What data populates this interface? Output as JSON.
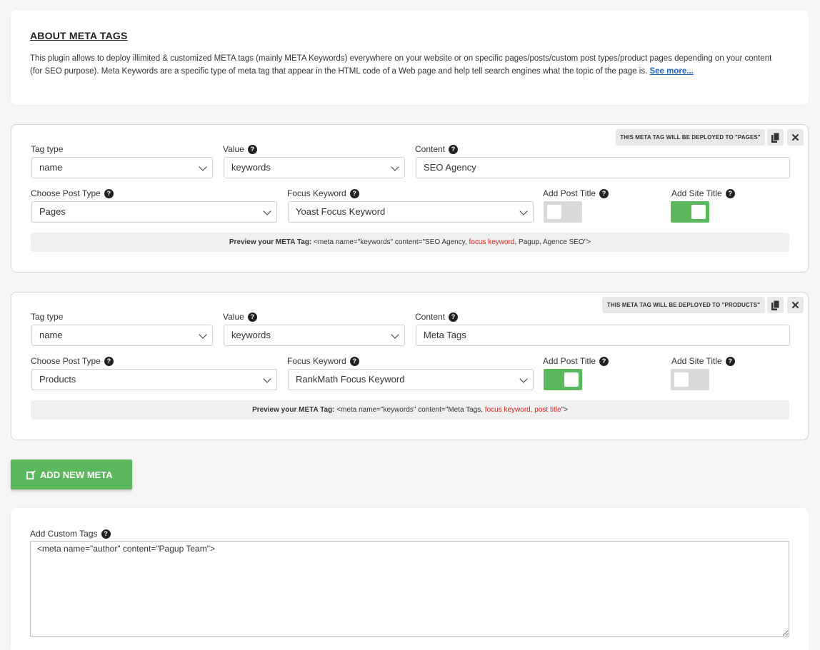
{
  "about": {
    "title": "ABOUT META TAGS",
    "description": "This plugin allows to deploy illimited & customized META tags (mainly META Keywords) everywhere on your website or on specific pages/posts/custom post types/product pages depending on your content (for SEO purpose). Meta Keywords are a specific type of meta tag that appear in the HTML code of a Web page and help tell search engines what the topic of the page is.",
    "see_more": "See more..."
  },
  "labels": {
    "tag_type": "Tag type",
    "value": "Value",
    "content": "Content",
    "choose_post_type": "Choose Post Type",
    "focus_keyword": "Focus Keyword",
    "add_post_title": "Add Post Title",
    "add_site_title": "Add Site Title",
    "preview": "Preview your META Tag:"
  },
  "meta_tags": [
    {
      "deploy_badge": "THIS META TAG WILL BE DEPLOYED TO \"PAGES\"",
      "tag_type": "name",
      "value": "keywords",
      "content": "SEO Agency",
      "post_type": "Pages",
      "focus_keyword": "Yoast Focus Keyword",
      "add_post_title": false,
      "add_site_title": true,
      "preview_before": "<meta name=\"keywords\" content=\"SEO Agency, ",
      "preview_red": "focus keyword",
      "preview_after": ", Pagup, Agence SEO\">"
    },
    {
      "deploy_badge": "THIS META TAG WILL BE DEPLOYED TO \"PRODUCTS\"",
      "tag_type": "name",
      "value": "keywords",
      "content": "Meta Tags",
      "post_type": "Products",
      "focus_keyword": "RankMath Focus Keyword",
      "add_post_title": true,
      "add_site_title": false,
      "preview_before": "<meta name=\"keywords\" content=\"Meta Tags, ",
      "preview_red": "focus keyword, post title",
      "preview_after": "\">"
    }
  ],
  "add_button": "ADD NEW META",
  "custom_tags": {
    "label": "Add Custom Tags",
    "value": "<meta name=\"author\" content=\"Pagup Team\">"
  },
  "colors": {
    "accent_green": "#5cb85c",
    "link_blue": "#1c64c8",
    "highlight_red": "#d9221d"
  },
  "icons": [
    "help-icon",
    "copy-icon",
    "close-icon",
    "chevron-down-icon",
    "add-note-icon"
  ]
}
